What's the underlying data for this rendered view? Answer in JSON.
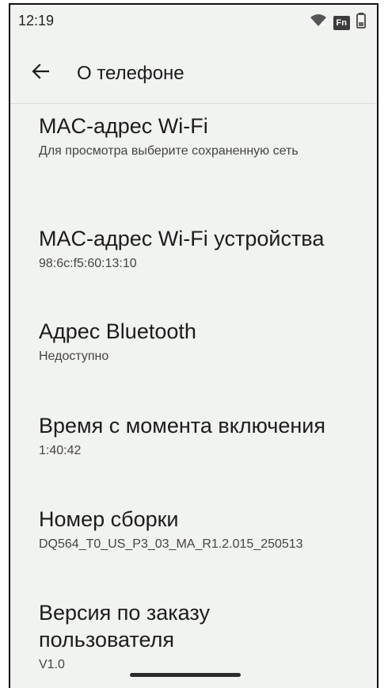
{
  "status_bar": {
    "time": "12:19",
    "fn_label": "Fn",
    "icons": [
      "wifi-icon",
      "fn-icon",
      "battery-icon"
    ]
  },
  "app_bar": {
    "title": "О телефоне",
    "back_icon": "back-arrow-icon"
  },
  "items": [
    {
      "title": "MAC-адрес Wi-Fi",
      "subtitle": "Для просмотра выберите сохраненную сеть"
    },
    {
      "title": "MAC-адрес Wi-Fi устройства",
      "subtitle": "98:6c:f5:60:13:10"
    },
    {
      "title": "Адрес Bluetooth",
      "subtitle": "Недоступно"
    },
    {
      "title": "Время с момента включения",
      "subtitle": "1:40:42"
    },
    {
      "title": "Номер сборки",
      "subtitle": "DQ564_T0_US_P3_03_MA_R1.2.015_250513"
    },
    {
      "title": "Версия по заказу пользователя",
      "subtitle": "V1.0"
    }
  ],
  "colors": {
    "background": "#f1f3f0",
    "text_primary": "#1c1c1c",
    "text_secondary": "#444444"
  }
}
